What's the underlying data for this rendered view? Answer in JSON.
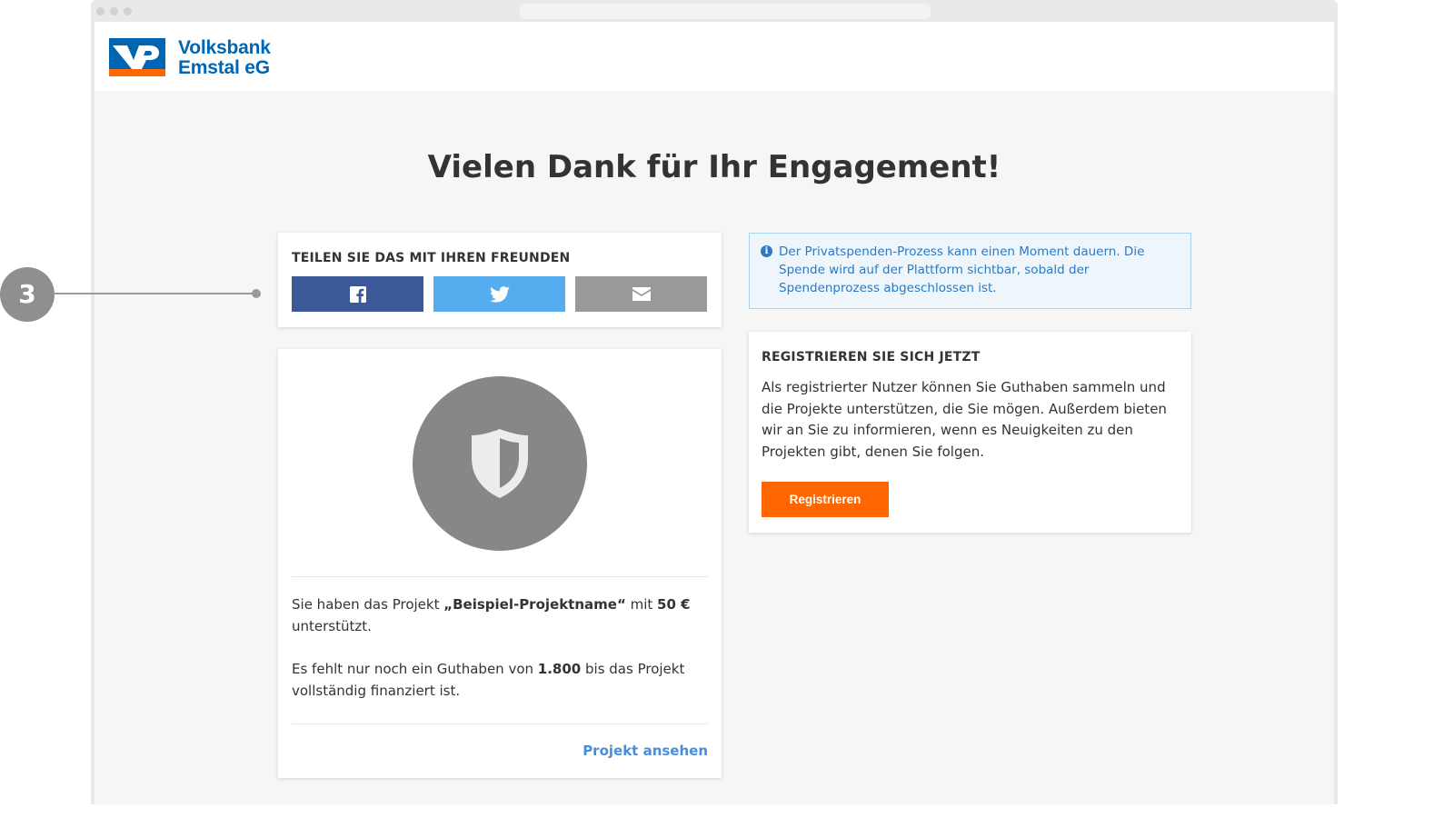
{
  "brand": {
    "name_line1": "Volksbank",
    "name_line2": "Emstal eG",
    "colors": {
      "blue": "#0066b3",
      "orange": "#ff6600"
    }
  },
  "page": {
    "title": "Vielen Dank für Ihr Engagement!"
  },
  "share": {
    "heading": "TEILEN SIE DAS MIT IHREN FREUNDEN",
    "buttons": [
      {
        "icon": "facebook-icon",
        "color": "#3b5998"
      },
      {
        "icon": "twitter-icon",
        "color": "#55acee"
      },
      {
        "icon": "envelope-icon",
        "color": "#999999"
      }
    ]
  },
  "project": {
    "icon": "shield-icon",
    "text1_prefix": "Sie haben das Projekt ",
    "project_name": "„Beispiel-Projektname“",
    "text1_mid": " mit ",
    "amount": "50 €",
    "text1_suffix": " unterstützt.",
    "text2_prefix": "Es fehlt nur noch ein Guthaben von ",
    "missing_amount": "1.800",
    "text2_suffix": " bis das Projekt vollständig finanziert ist.",
    "link_label": "Projekt ansehen"
  },
  "info": {
    "icon": "info-icon",
    "text": "Der Privatspenden-Prozess kann einen Moment dauern. Die Spende wird auf der Plattform sichtbar, sobald der Spendenprozess abgeschlossen ist."
  },
  "register": {
    "heading": "REGISTRIEREN SIE SICH JETZT",
    "text": "Als registrierter Nutzer können Sie Guthaben sammeln und die Projekte unterstützen, die Sie mögen. Außerdem bieten wir an Sie zu informieren, wenn es Neuigkeiten zu den Projekten gibt, denen Sie folgen.",
    "button_label": "Registrieren"
  },
  "annotation": {
    "number": "3"
  }
}
